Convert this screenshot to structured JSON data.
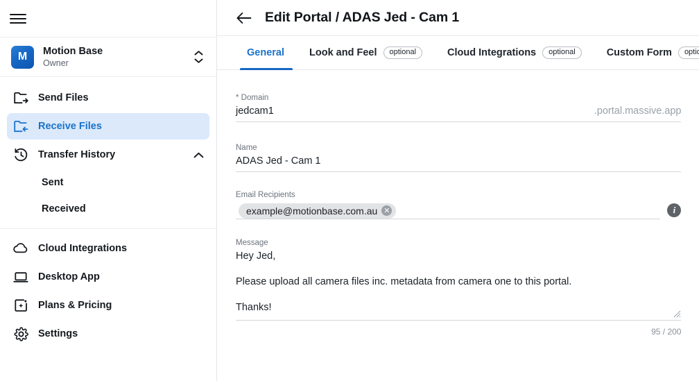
{
  "sidebar": {
    "menu_icon": "hamburger-icon",
    "brand_mark": "·",
    "workspace": {
      "avatar_letter": "M",
      "name": "Motion Base",
      "role": "Owner",
      "switch_icon": "chevron-updown-icon",
      "avatar_color": "#1667c4"
    },
    "items": [
      {
        "label": "Send Files",
        "icon": "folder-out-icon",
        "active": false
      },
      {
        "label": "Receive Files",
        "icon": "folder-in-icon",
        "active": true
      },
      {
        "label": "Transfer History",
        "icon": "history-icon",
        "active": false,
        "expanded": true,
        "chevron": "chevron-up-icon"
      }
    ],
    "sub_items": [
      {
        "label": "Sent"
      },
      {
        "label": "Received"
      }
    ],
    "bottom_items": [
      {
        "label": "Cloud Integrations",
        "icon": "cloud-icon"
      },
      {
        "label": "Desktop App",
        "icon": "laptop-icon"
      },
      {
        "label": "Plans & Pricing",
        "icon": "sparkle-square-icon"
      },
      {
        "label": "Settings",
        "icon": "gear-icon"
      }
    ],
    "active_color": "#1a73c9",
    "active_bg": "#dbe9fb"
  },
  "header": {
    "back_icon": "arrow-left-icon",
    "title": "Edit Portal / ADAS Jed - Cam 1"
  },
  "tabs": [
    {
      "label": "General",
      "optional": "",
      "active": true
    },
    {
      "label": "Look and Feel",
      "optional": "optional",
      "active": false
    },
    {
      "label": "Cloud Integrations",
      "optional": "optional",
      "active": false
    },
    {
      "label": "Custom Form",
      "optional": "optional",
      "active": false
    }
  ],
  "form": {
    "domain": {
      "label": "* Domain",
      "value": "jedcam1",
      "suffix": ".portal.massive.app",
      "placeholder": "Domain"
    },
    "name": {
      "label": "Name",
      "value": "ADAS Jed - Cam 1",
      "placeholder": "Name"
    },
    "email_recipients": {
      "label": "Email Recipients",
      "chips": [
        {
          "email": "example@motionbase.com.au",
          "remove_icon": "close-circle-icon"
        }
      ],
      "info_icon": "info-icon",
      "placeholder": "Email Recipients"
    },
    "message": {
      "label": "Message",
      "lines": [
        "Hey Jed,",
        "",
        "Please upload all camera files inc. metadata from camera one to this portal.",
        "",
        "Thanks!"
      ],
      "resize_icon": "resize-handle-icon",
      "counter": "95 / 200",
      "placeholder": "Message"
    }
  }
}
